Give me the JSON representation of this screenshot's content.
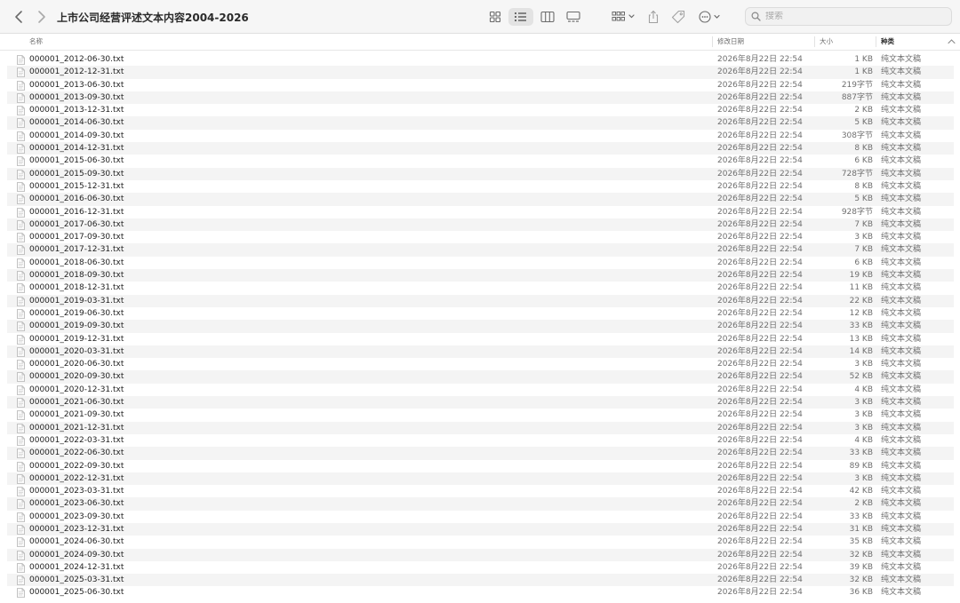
{
  "window": {
    "title": "上市公司经营评述文本内容2004-2026"
  },
  "toolbar": {
    "back": "chevron-left-icon",
    "forward": "chevron-right-icon",
    "view_icons": "icon-view-icon",
    "view_list": "list-view-icon",
    "view_columns": "column-view-icon",
    "view_gallery": "gallery-view-icon",
    "group": "group-icon",
    "share": "share-icon",
    "tag": "tag-icon",
    "more": "more-icon"
  },
  "search": {
    "placeholder": "搜索"
  },
  "columns": {
    "name": "名称",
    "date": "修改日期",
    "size": "大小",
    "kind": "种类"
  },
  "files": [
    {
      "name": "000001_2012-06-30.txt",
      "date": "2026年8月22日 22:54",
      "size": "1 KB",
      "kind": "纯文本文稿"
    },
    {
      "name": "000001_2012-12-31.txt",
      "date": "2026年8月22日 22:54",
      "size": "1 KB",
      "kind": "纯文本文稿"
    },
    {
      "name": "000001_2013-06-30.txt",
      "date": "2026年8月22日 22:54",
      "size": "219字节",
      "kind": "纯文本文稿"
    },
    {
      "name": "000001_2013-09-30.txt",
      "date": "2026年8月22日 22:54",
      "size": "887字节",
      "kind": "纯文本文稿"
    },
    {
      "name": "000001_2013-12-31.txt",
      "date": "2026年8月22日 22:54",
      "size": "2 KB",
      "kind": "纯文本文稿"
    },
    {
      "name": "000001_2014-06-30.txt",
      "date": "2026年8月22日 22:54",
      "size": "5 KB",
      "kind": "纯文本文稿"
    },
    {
      "name": "000001_2014-09-30.txt",
      "date": "2026年8月22日 22:54",
      "size": "308字节",
      "kind": "纯文本文稿"
    },
    {
      "name": "000001_2014-12-31.txt",
      "date": "2026年8月22日 22:54",
      "size": "8 KB",
      "kind": "纯文本文稿"
    },
    {
      "name": "000001_2015-06-30.txt",
      "date": "2026年8月22日 22:54",
      "size": "6 KB",
      "kind": "纯文本文稿"
    },
    {
      "name": "000001_2015-09-30.txt",
      "date": "2026年8月22日 22:54",
      "size": "728字节",
      "kind": "纯文本文稿"
    },
    {
      "name": "000001_2015-12-31.txt",
      "date": "2026年8月22日 22:54",
      "size": "8 KB",
      "kind": "纯文本文稿"
    },
    {
      "name": "000001_2016-06-30.txt",
      "date": "2026年8月22日 22:54",
      "size": "5 KB",
      "kind": "纯文本文稿"
    },
    {
      "name": "000001_2016-12-31.txt",
      "date": "2026年8月22日 22:54",
      "size": "928字节",
      "kind": "纯文本文稿"
    },
    {
      "name": "000001_2017-06-30.txt",
      "date": "2026年8月22日 22:54",
      "size": "7 KB",
      "kind": "纯文本文稿"
    },
    {
      "name": "000001_2017-09-30.txt",
      "date": "2026年8月22日 22:54",
      "size": "3 KB",
      "kind": "纯文本文稿"
    },
    {
      "name": "000001_2017-12-31.txt",
      "date": "2026年8月22日 22:54",
      "size": "7 KB",
      "kind": "纯文本文稿"
    },
    {
      "name": "000001_2018-06-30.txt",
      "date": "2026年8月22日 22:54",
      "size": "6 KB",
      "kind": "纯文本文稿"
    },
    {
      "name": "000001_2018-09-30.txt",
      "date": "2026年8月22日 22:54",
      "size": "19 KB",
      "kind": "纯文本文稿"
    },
    {
      "name": "000001_2018-12-31.txt",
      "date": "2026年8月22日 22:54",
      "size": "11 KB",
      "kind": "纯文本文稿"
    },
    {
      "name": "000001_2019-03-31.txt",
      "date": "2026年8月22日 22:54",
      "size": "22 KB",
      "kind": "纯文本文稿"
    },
    {
      "name": "000001_2019-06-30.txt",
      "date": "2026年8月22日 22:54",
      "size": "12 KB",
      "kind": "纯文本文稿"
    },
    {
      "name": "000001_2019-09-30.txt",
      "date": "2026年8月22日 22:54",
      "size": "33 KB",
      "kind": "纯文本文稿"
    },
    {
      "name": "000001_2019-12-31.txt",
      "date": "2026年8月22日 22:54",
      "size": "13 KB",
      "kind": "纯文本文稿"
    },
    {
      "name": "000001_2020-03-31.txt",
      "date": "2026年8月22日 22:54",
      "size": "14 KB",
      "kind": "纯文本文稿"
    },
    {
      "name": "000001_2020-06-30.txt",
      "date": "2026年8月22日 22:54",
      "size": "3 KB",
      "kind": "纯文本文稿"
    },
    {
      "name": "000001_2020-09-30.txt",
      "date": "2026年8月22日 22:54",
      "size": "52 KB",
      "kind": "纯文本文稿"
    },
    {
      "name": "000001_2020-12-31.txt",
      "date": "2026年8月22日 22:54",
      "size": "4 KB",
      "kind": "纯文本文稿"
    },
    {
      "name": "000001_2021-06-30.txt",
      "date": "2026年8月22日 22:54",
      "size": "3 KB",
      "kind": "纯文本文稿"
    },
    {
      "name": "000001_2021-09-30.txt",
      "date": "2026年8月22日 22:54",
      "size": "3 KB",
      "kind": "纯文本文稿"
    },
    {
      "name": "000001_2021-12-31.txt",
      "date": "2026年8月22日 22:54",
      "size": "3 KB",
      "kind": "纯文本文稿"
    },
    {
      "name": "000001_2022-03-31.txt",
      "date": "2026年8月22日 22:54",
      "size": "4 KB",
      "kind": "纯文本文稿"
    },
    {
      "name": "000001_2022-06-30.txt",
      "date": "2026年8月22日 22:54",
      "size": "33 KB",
      "kind": "纯文本文稿"
    },
    {
      "name": "000001_2022-09-30.txt",
      "date": "2026年8月22日 22:54",
      "size": "89 KB",
      "kind": "纯文本文稿"
    },
    {
      "name": "000001_2022-12-31.txt",
      "date": "2026年8月22日 22:54",
      "size": "3 KB",
      "kind": "纯文本文稿"
    },
    {
      "name": "000001_2023-03-31.txt",
      "date": "2026年8月22日 22:54",
      "size": "42 KB",
      "kind": "纯文本文稿"
    },
    {
      "name": "000001_2023-06-30.txt",
      "date": "2026年8月22日 22:54",
      "size": "2 KB",
      "kind": "纯文本文稿"
    },
    {
      "name": "000001_2023-09-30.txt",
      "date": "2026年8月22日 22:54",
      "size": "33 KB",
      "kind": "纯文本文稿"
    },
    {
      "name": "000001_2023-12-31.txt",
      "date": "2026年8月22日 22:54",
      "size": "31 KB",
      "kind": "纯文本文稿"
    },
    {
      "name": "000001_2024-06-30.txt",
      "date": "2026年8月22日 22:54",
      "size": "35 KB",
      "kind": "纯文本文稿"
    },
    {
      "name": "000001_2024-09-30.txt",
      "date": "2026年8月22日 22:54",
      "size": "32 KB",
      "kind": "纯文本文稿"
    },
    {
      "name": "000001_2024-12-31.txt",
      "date": "2026年8月22日 22:54",
      "size": "39 KB",
      "kind": "纯文本文稿"
    },
    {
      "name": "000001_2025-03-31.txt",
      "date": "2026年8月22日 22:54",
      "size": "32 KB",
      "kind": "纯文本文稿"
    },
    {
      "name": "000001_2025-06-30.txt",
      "date": "2026年8月22日 22:54",
      "size": "36 KB",
      "kind": "纯文本文稿"
    }
  ]
}
